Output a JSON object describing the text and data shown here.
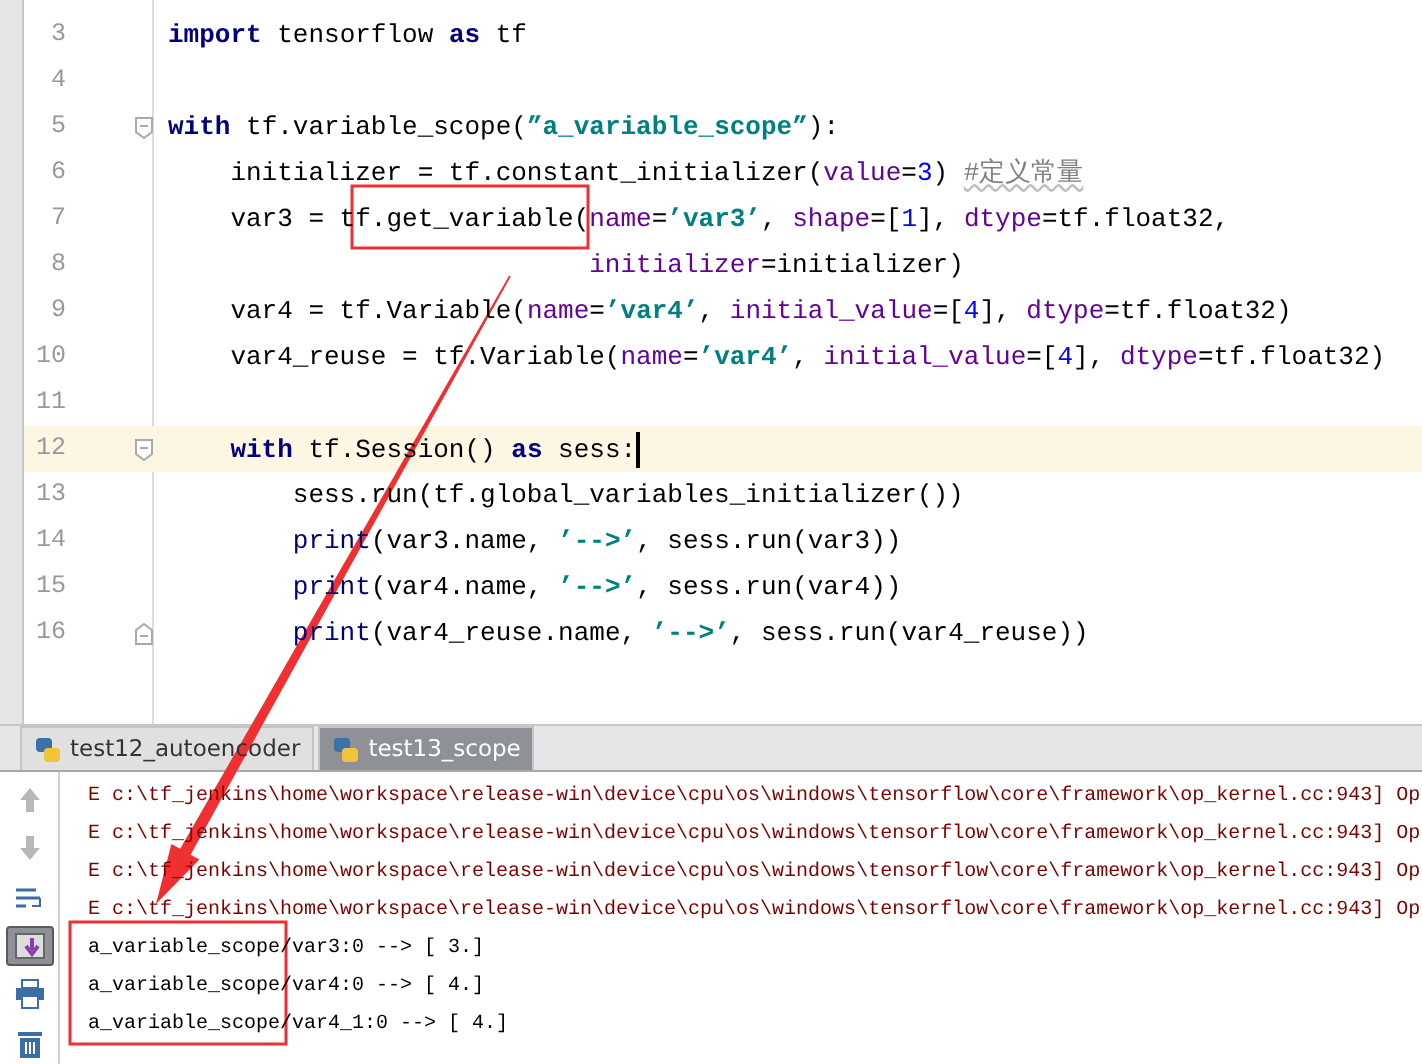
{
  "editor": {
    "lines": [
      {
        "number": "3",
        "current": false,
        "tokens": [
          {
            "kind": "keyword",
            "text": "import"
          },
          {
            "kind": "plain",
            "text": " tensorflow "
          },
          {
            "kind": "keyword",
            "text": "as"
          },
          {
            "kind": "plain",
            "text": " tf"
          }
        ]
      },
      {
        "number": "4",
        "current": false
      },
      {
        "number": "5",
        "current": false,
        "fold_start": true,
        "tokens": [
          {
            "kind": "keyword",
            "text": "with"
          },
          {
            "kind": "plain",
            "text": " tf.variable_scope("
          },
          {
            "kind": "string",
            "text": "”a_variable_scope”"
          },
          {
            "kind": "plain",
            "text": "):"
          }
        ],
        "children": [
          {
            "number": "6",
            "current": false,
            "tokens": [
              {
                "kind": "plain",
                "text": "initializer = tf.constant_initializer("
              },
              {
                "kind": "param",
                "text": "value"
              },
              {
                "kind": "plain",
                "text": "="
              },
              {
                "kind": "number",
                "text": "3"
              },
              {
                "kind": "plain",
                "text": ") "
              },
              {
                "kind": "comment",
                "text": "#定义常量"
              }
            ]
          },
          {
            "number": "7",
            "current": false,
            "tokens": [
              {
                "kind": "plain",
                "text": "var3 = tf.get_variable("
              },
              {
                "kind": "param",
                "text": "name"
              },
              {
                "kind": "plain",
                "text": "="
              },
              {
                "kind": "string",
                "text": "’var3’"
              },
              {
                "kind": "plain",
                "text": ", "
              },
              {
                "kind": "param",
                "text": "shape"
              },
              {
                "kind": "plain",
                "text": "=["
              },
              {
                "kind": "number",
                "text": "1"
              },
              {
                "kind": "plain",
                "text": "], "
              },
              {
                "kind": "param",
                "text": "dtype"
              },
              {
                "kind": "plain",
                "text": "=tf.float32,"
              }
            ]
          },
          {
            "number": "8",
            "current": false,
            "kind": "continuation",
            "tokens": [
              {
                "kind": "param",
                "text": "initializer"
              },
              {
                "kind": "plain",
                "text": "=initializer)"
              }
            ]
          },
          {
            "number": "9",
            "current": false,
            "tokens": [
              {
                "kind": "plain",
                "text": "var4 = tf.Variable("
              },
              {
                "kind": "param",
                "text": "name"
              },
              {
                "kind": "plain",
                "text": "="
              },
              {
                "kind": "string",
                "text": "’var4’"
              },
              {
                "kind": "plain",
                "text": ", "
              },
              {
                "kind": "param",
                "text": "initial_value"
              },
              {
                "kind": "plain",
                "text": "=["
              },
              {
                "kind": "number",
                "text": "4"
              },
              {
                "kind": "plain",
                "text": "], "
              },
              {
                "kind": "param",
                "text": "dtype"
              },
              {
                "kind": "plain",
                "text": "=tf.float32)"
              }
            ]
          },
          {
            "number": "10",
            "current": false,
            "tokens": [
              {
                "kind": "plain",
                "text": "var4_reuse = tf.Variable("
              },
              {
                "kind": "param",
                "text": "name"
              },
              {
                "kind": "plain",
                "text": "="
              },
              {
                "kind": "string",
                "text": "’var4’"
              },
              {
                "kind": "plain",
                "text": ", "
              },
              {
                "kind": "param",
                "text": "initial_value"
              },
              {
                "kind": "plain",
                "text": "=["
              },
              {
                "kind": "number",
                "text": "4"
              },
              {
                "kind": "plain",
                "text": "], "
              },
              {
                "kind": "param",
                "text": "dtype"
              },
              {
                "kind": "plain",
                "text": "=tf.float32)"
              }
            ]
          },
          {
            "number": "11",
            "current": false
          },
          {
            "number": "12",
            "current": true,
            "fold_start": true,
            "tokens": [
              {
                "kind": "keyword",
                "text": "with"
              },
              {
                "kind": "plain",
                "text": " tf.Session() "
              },
              {
                "kind": "keyword",
                "text": "as"
              },
              {
                "kind": "plain",
                "text": " sess:"
              }
            ],
            "children": [
              {
                "number": "13",
                "current": false,
                "tokens": [
                  {
                    "kind": "plain",
                    "text": "sess.run(tf.global_variables_initializer())"
                  }
                ]
              },
              {
                "number": "14",
                "current": false,
                "tokens": [
                  {
                    "kind": "builtin",
                    "text": "print"
                  },
                  {
                    "kind": "plain",
                    "text": "(var3.name, "
                  },
                  {
                    "kind": "string",
                    "text": "’-->’"
                  },
                  {
                    "kind": "plain",
                    "text": ", sess.run(var3))"
                  }
                ]
              },
              {
                "number": "15",
                "current": false,
                "tokens": [
                  {
                    "kind": "builtin",
                    "text": "print"
                  },
                  {
                    "kind": "plain",
                    "text": "(var4.name, "
                  },
                  {
                    "kind": "string",
                    "text": "’-->’"
                  },
                  {
                    "kind": "plain",
                    "text": ", sess.run(var4))"
                  }
                ]
              },
              {
                "number": "16",
                "current": false,
                "fold_end": true,
                "tokens": [
                  {
                    "kind": "builtin",
                    "text": "print"
                  },
                  {
                    "kind": "plain",
                    "text": "(var4_reuse.name, "
                  },
                  {
                    "kind": "string",
                    "text": "’-->’"
                  },
                  {
                    "kind": "plain",
                    "text": ", sess.run(var4_reuse))"
                  }
                ]
              }
            ]
          }
        ]
      }
    ]
  },
  "run_panel": {
    "tabs": [
      {
        "label": "test12_autoencoder",
        "selected": false
      },
      {
        "label": "test13_scope",
        "selected": true
      }
    ],
    "toolbar": [
      {
        "kind": "up",
        "selected": false
      },
      {
        "kind": "down",
        "selected": false
      },
      {
        "kind": "wrap",
        "selected": false
      },
      {
        "kind": "scroll_end",
        "selected": true
      },
      {
        "kind": "print",
        "selected": false
      },
      {
        "kind": "delete",
        "selected": false
      }
    ],
    "output": [
      {
        "kind": "error",
        "text": "E c:\\tf_jenkins\\home\\workspace\\release-win\\device\\cpu\\os\\windows\\tensorflow\\core\\framework\\op_kernel.cc:943] Op"
      },
      {
        "kind": "error",
        "text": "E c:\\tf_jenkins\\home\\workspace\\release-win\\device\\cpu\\os\\windows\\tensorflow\\core\\framework\\op_kernel.cc:943] Op"
      },
      {
        "kind": "error",
        "text": "E c:\\tf_jenkins\\home\\workspace\\release-win\\device\\cpu\\os\\windows\\tensorflow\\core\\framework\\op_kernel.cc:943] Op"
      },
      {
        "kind": "error",
        "text": "E c:\\tf_jenkins\\home\\workspace\\release-win\\device\\cpu\\os\\windows\\tensorflow\\core\\framework\\op_kernel.cc:943] Op"
      },
      {
        "kind": "result",
        "text": "a_variable_scope/var3:0 --> [ 3.]"
      },
      {
        "kind": "result",
        "text": "a_variable_scope/var4:0 --> [ 4.]"
      },
      {
        "kind": "result",
        "text": "a_variable_scope/var4_1:0 --> [ 4.]"
      }
    ]
  }
}
